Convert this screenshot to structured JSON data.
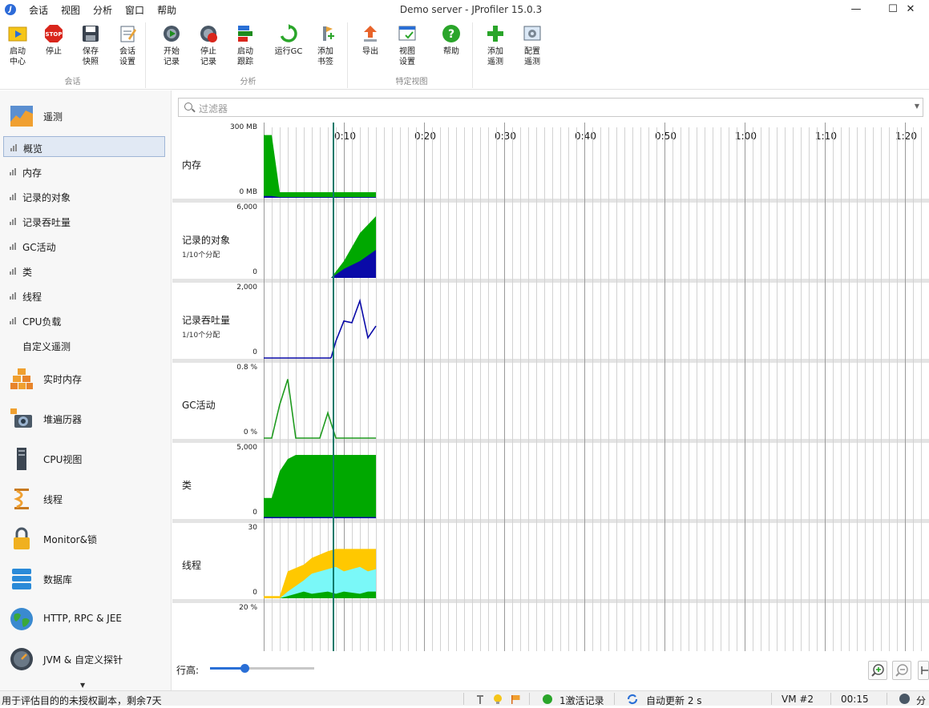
{
  "window": {
    "title": "Demo server - JProfiler 15.0.3"
  },
  "menu": [
    "会话",
    "视图",
    "分析",
    "窗口",
    "帮助"
  ],
  "toolbar": {
    "groups": [
      "会话",
      "分析",
      "特定视图"
    ],
    "buttons": [
      {
        "line1": "启动",
        "line2": "中心",
        "icon": "start-center-icon"
      },
      {
        "line1": "停止",
        "line2": "",
        "icon": "stop-icon"
      },
      {
        "line1": "保存",
        "line2": "快照",
        "icon": "save-snapshot-icon"
      },
      {
        "line1": "会话",
        "line2": "设置",
        "icon": "session-settings-icon"
      },
      {
        "line1": "开始",
        "line2": "记录",
        "icon": "start-recording-icon"
      },
      {
        "line1": "停止",
        "line2": "记录",
        "icon": "stop-recording-icon"
      },
      {
        "line1": "启动",
        "line2": "跟踪",
        "icon": "start-tracking-icon"
      },
      {
        "line1": "运行GC",
        "line2": "",
        "icon": "run-gc-icon"
      },
      {
        "line1": "添加",
        "line2": "书签",
        "icon": "add-bookmark-icon"
      },
      {
        "line1": "导出",
        "line2": "",
        "icon": "export-icon"
      },
      {
        "line1": "视图",
        "line2": "设置",
        "icon": "view-settings-icon"
      },
      {
        "line1": "帮助",
        "line2": "",
        "icon": "help-icon"
      },
      {
        "line1": "添加",
        "line2": "遥测",
        "icon": "add-telemetry-icon"
      },
      {
        "line1": "配置",
        "line2": "遥测",
        "icon": "configure-telemetry-icon"
      }
    ]
  },
  "sidebar": {
    "telemetry_section": "遥测",
    "items": [
      "概览",
      "内存",
      "记录的对象",
      "记录吞吐量",
      "GC活动",
      "类",
      "线程",
      "CPU负载",
      "自定义遥测"
    ],
    "selected_index": 0,
    "sections": [
      "实时内存",
      "堆遍历器",
      "CPU视图",
      "线程",
      "Monitor&锁",
      "数据库",
      "HTTP, RPC & JEE",
      "JVM & 自定义探针"
    ]
  },
  "filter": {
    "placeholder": "过滤器"
  },
  "timeline": {
    "ticks": [
      "0:10",
      "0:20",
      "0:30",
      "0:40",
      "0:50",
      "1:00",
      "1:10",
      "1:20"
    ],
    "tick_seconds": [
      10,
      20,
      30,
      40,
      50,
      60,
      70,
      80
    ],
    "current_time_s": 8.7,
    "recorded_until_s": 14
  },
  "telemetries": [
    {
      "label": "内存",
      "sub": "",
      "ymax": "300 MB",
      "ymin": "0 MB"
    },
    {
      "label": "记录的对象",
      "sub": "1/10个分配",
      "ymax": "6,000",
      "ymin": "0"
    },
    {
      "label": "记录吞吐量",
      "sub": "1/10个分配",
      "ymax": "2,000",
      "ymin": "0"
    },
    {
      "label": "GC活动",
      "sub": "",
      "ymax": "0.8 %",
      "ymin": "0 %"
    },
    {
      "label": "类",
      "sub": "",
      "ymax": "5,000",
      "ymin": "0"
    },
    {
      "label": "线程",
      "sub": "",
      "ymax": "30",
      "ymin": "0"
    },
    {
      "label": "",
      "sub": "",
      "ymax": "20 %",
      "ymin": ""
    }
  ],
  "chart_data": [
    {
      "type": "area",
      "title": "内存",
      "x": [
        0,
        1,
        2,
        14
      ],
      "series": [
        {
          "name": "",
          "values": [
            280,
            280,
            25,
            25
          ]
        }
      ],
      "ylim": [
        0,
        300
      ]
    },
    {
      "type": "area",
      "title": "记录的对象",
      "x": [
        8.4,
        10,
        12,
        14
      ],
      "series": [
        {
          "name": "",
          "values": [
            0,
            1500,
            4000,
            5500
          ]
        },
        {
          "name": "",
          "values": [
            0,
            800,
            1500,
            2500
          ]
        }
      ],
      "ylim": [
        0,
        6000
      ]
    },
    {
      "type": "line",
      "title": "记录吞吐量",
      "x": [
        8.4,
        9,
        10,
        11,
        12,
        13,
        14
      ],
      "series": [
        {
          "name": "",
          "values": [
            0,
            500,
            1100,
            1050,
            1700,
            600,
            950
          ]
        }
      ],
      "ylim": [
        0,
        2000
      ]
    },
    {
      "type": "line",
      "title": "GC活动",
      "x": [
        0,
        1,
        2,
        3,
        4,
        7,
        8,
        9,
        14
      ],
      "series": [
        {
          "name": "",
          "values": [
            0,
            0,
            0.4,
            0.7,
            0,
            0,
            0.3,
            0,
            0
          ]
        }
      ],
      "ylim": [
        0,
        0.8
      ]
    },
    {
      "type": "area",
      "title": "类",
      "x": [
        0,
        1,
        2,
        3,
        4,
        5,
        14
      ],
      "series": [
        {
          "name": "",
          "values": [
            1500,
            1500,
            3500,
            4400,
            4700,
            4700,
            4700
          ]
        }
      ],
      "ylim": [
        0,
        5000
      ]
    },
    {
      "type": "area",
      "title": "线程",
      "x": [
        0,
        2,
        3,
        5,
        6,
        8,
        9,
        10,
        12,
        13,
        14
      ],
      "series": [
        {
          "name": "",
          "values": [
            1,
            1,
            12,
            15,
            18,
            21,
            22,
            22,
            22,
            22,
            22
          ]
        },
        {
          "name": "",
          "values": [
            0,
            0,
            3,
            8,
            11,
            13,
            14,
            12,
            14,
            12,
            13
          ]
        },
        {
          "name": "",
          "values": [
            0,
            0,
            1,
            3,
            2,
            3,
            2,
            3,
            2,
            3,
            3
          ]
        }
      ],
      "ylim": [
        0,
        30
      ]
    }
  ],
  "controls": {
    "row_height_label": "行高:",
    "row_height_level": 0.33
  },
  "statusbar": {
    "license": "用于评估目的的未授权副本，剩余7天",
    "recording": "1激活记录",
    "autoupdate": "自动更新 2 s",
    "vm": "VM #2",
    "time": "00:15",
    "right": "分"
  },
  "colors": {
    "green": "#00a800",
    "blue": "#0a0aa8",
    "yellow": "#ffc800",
    "cyan": "#7af8f8",
    "cursor": "#0e7a6a"
  }
}
